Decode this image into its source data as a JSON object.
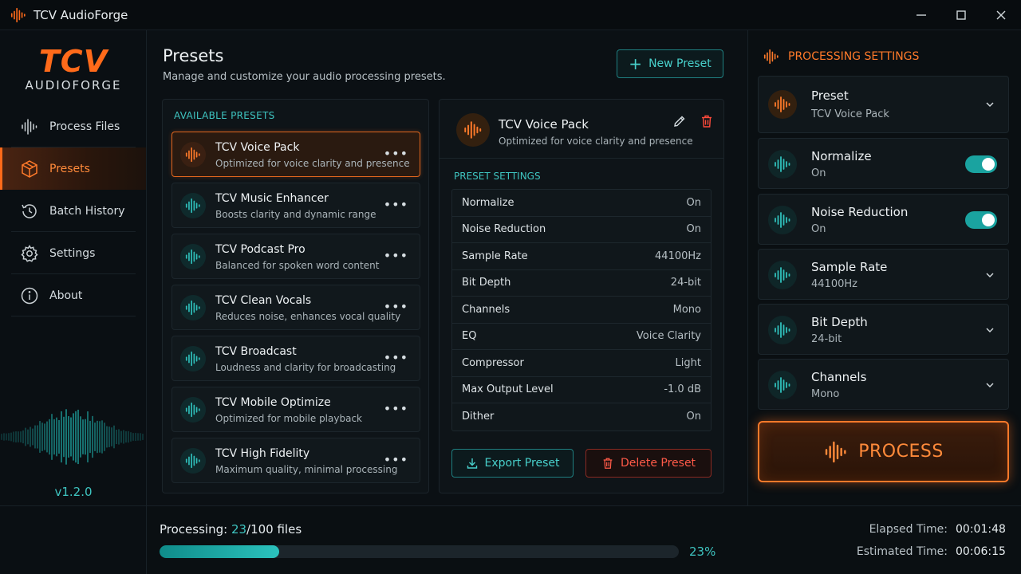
{
  "app": {
    "title": "TCV AudioForge",
    "logo_top": "TCV",
    "logo_bottom": "AUDIOFORGE",
    "version": "v1.2.0"
  },
  "colors": {
    "accent_orange": "#ff6a1a",
    "accent_teal": "#3ec4c0",
    "danger": "#ff5a48",
    "background": "#0b1014"
  },
  "nav": {
    "items": [
      {
        "label": "Process Files",
        "icon": "waveform-icon",
        "active": false
      },
      {
        "label": "Presets",
        "icon": "cube-icon",
        "active": true
      },
      {
        "label": "Batch History",
        "icon": "history-icon",
        "active": false
      },
      {
        "label": "Settings",
        "icon": "gear-icon",
        "active": false
      },
      {
        "label": "About",
        "icon": "info-icon",
        "active": false
      }
    ]
  },
  "page": {
    "title": "Presets",
    "subtitle": "Manage and customize your audio processing presets.",
    "new_preset_label": "New Preset"
  },
  "presets": {
    "heading": "AVAILABLE PRESETS",
    "items": [
      {
        "title": "TCV Voice Pack",
        "desc": "Optimized for voice clarity and presence",
        "selected": true
      },
      {
        "title": "TCV Music Enhancer",
        "desc": "Boosts clarity and dynamic range",
        "selected": false
      },
      {
        "title": "TCV Podcast Pro",
        "desc": "Balanced for spoken word content",
        "selected": false
      },
      {
        "title": "TCV Clean Vocals",
        "desc": "Reduces noise, enhances vocal quality",
        "selected": false
      },
      {
        "title": "TCV Broadcast",
        "desc": "Loudness and clarity for broadcasting",
        "selected": false
      },
      {
        "title": "TCV Mobile Optimize",
        "desc": "Optimized for mobile playback",
        "selected": false
      },
      {
        "title": "TCV High Fidelity",
        "desc": "Maximum quality, minimal processing",
        "selected": false
      }
    ]
  },
  "detail": {
    "title": "TCV Voice Pack",
    "desc": "Optimized for voice clarity and presence",
    "settings_heading": "PRESET SETTINGS",
    "settings": [
      {
        "label": "Normalize",
        "value": "On"
      },
      {
        "label": "Noise Reduction",
        "value": "On"
      },
      {
        "label": "Sample Rate",
        "value": "44100Hz"
      },
      {
        "label": "Bit Depth",
        "value": "24-bit"
      },
      {
        "label": "Channels",
        "value": "Mono"
      },
      {
        "label": "EQ",
        "value": "Voice Clarity"
      },
      {
        "label": "Compressor",
        "value": "Light"
      },
      {
        "label": "Max Output Level",
        "value": "-1.0 dB"
      },
      {
        "label": "Dither",
        "value": "On"
      }
    ],
    "export_label": "Export Preset",
    "delete_label": "Delete Preset"
  },
  "processing": {
    "heading": "PROCESSING SETTINGS",
    "preset": {
      "label": "Preset",
      "value": "TCV Voice Pack"
    },
    "normalize": {
      "label": "Normalize",
      "value": "On",
      "enabled": true
    },
    "noise_reduction": {
      "label": "Noise Reduction",
      "value": "On",
      "enabled": true
    },
    "sample_rate": {
      "label": "Sample Rate",
      "value": "44100Hz"
    },
    "bit_depth": {
      "label": "Bit Depth",
      "value": "24-bit"
    },
    "channels": {
      "label": "Channels",
      "value": "Mono"
    },
    "process_label": "PROCESS"
  },
  "status": {
    "label": "Processing:",
    "current": "23",
    "total": "/100 files",
    "percent": 23,
    "percent_text": "23%",
    "elapsed_label": "Elapsed Time:",
    "elapsed": "00:01:48",
    "estimated_label": "Estimated Time:",
    "estimated": "00:06:15"
  }
}
